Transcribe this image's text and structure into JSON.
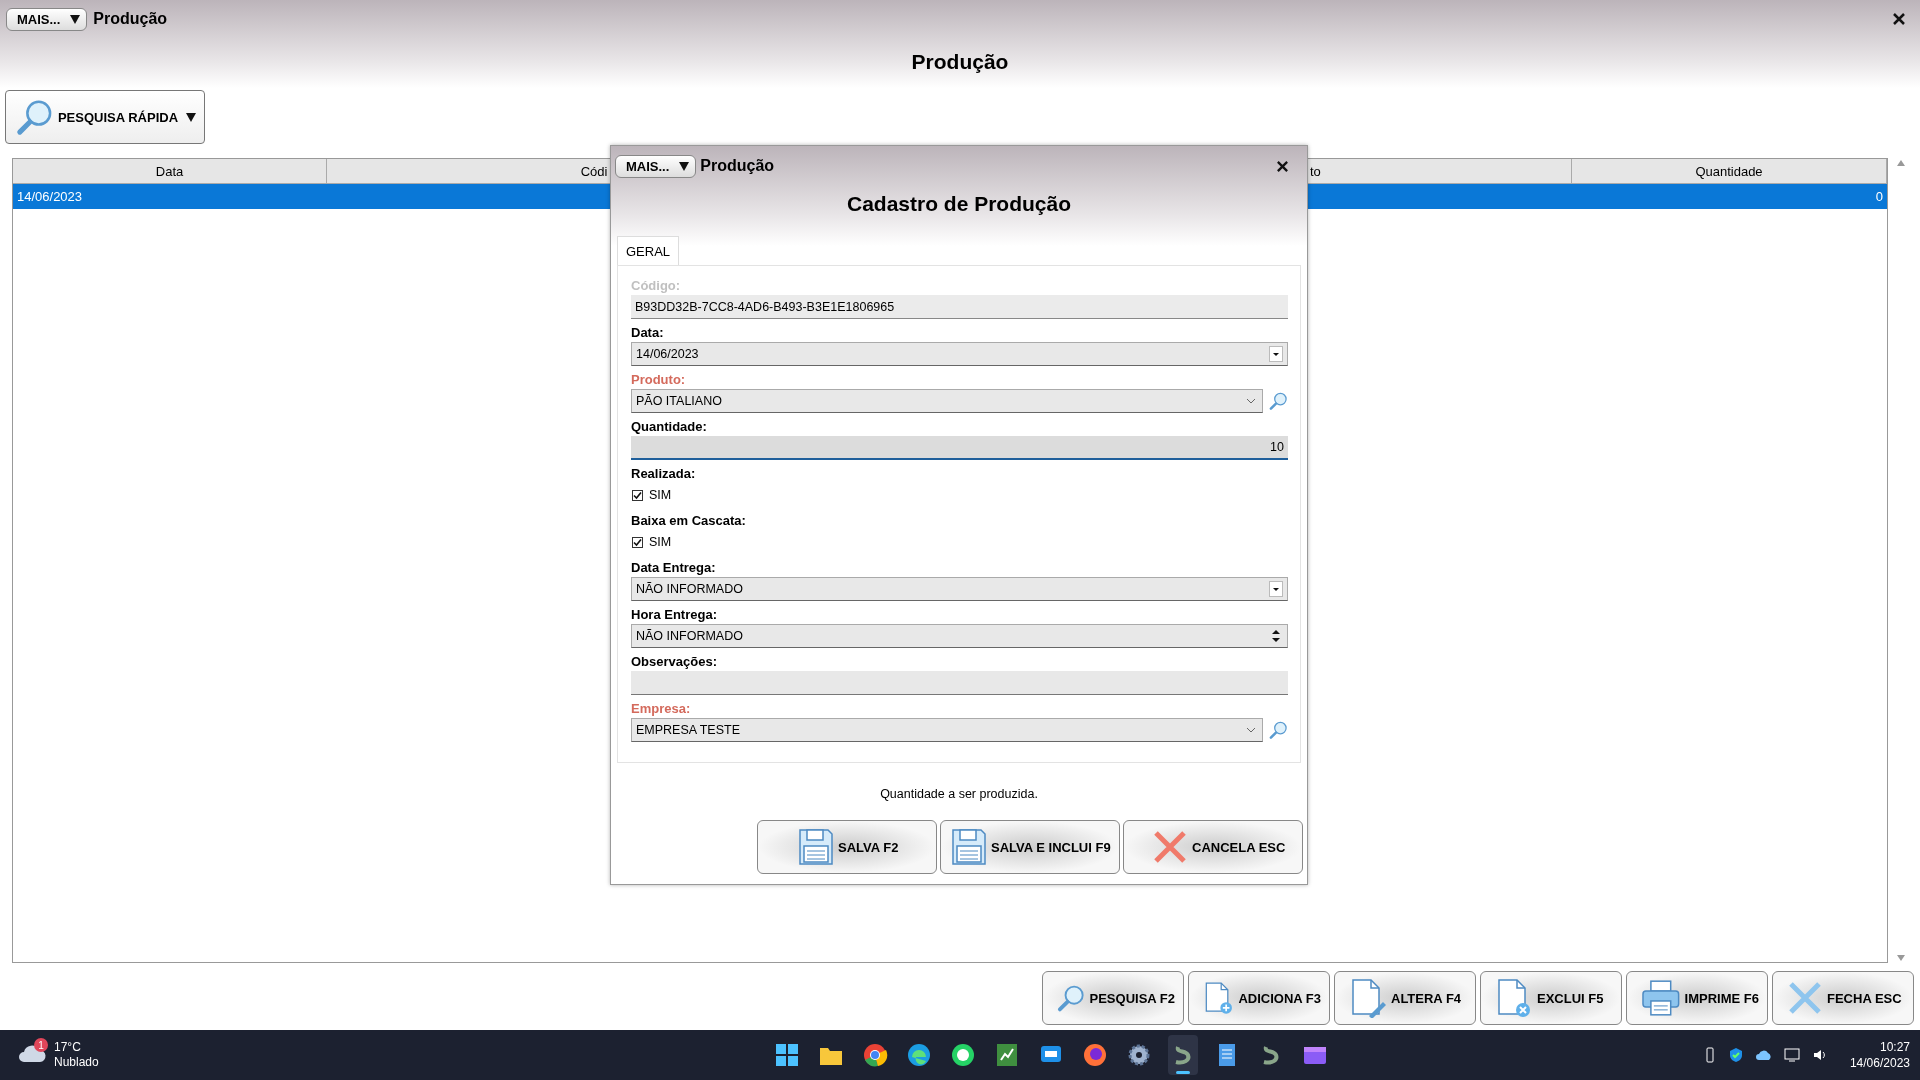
{
  "window": {
    "menu_button": "MAIS...",
    "title": "Produção",
    "heading": "Produção"
  },
  "quick_search": {
    "label": "PESQUISA RÁPIDA"
  },
  "table": {
    "columns": [
      "Data",
      "Códi",
      "to",
      "Quantidade"
    ],
    "rows": [
      {
        "data": "14/06/2023",
        "quantidade": "0",
        "selected": true
      }
    ]
  },
  "dialog": {
    "menu_button": "MAIS...",
    "title": "Produção",
    "heading": "Cadastro de Produção",
    "tabs": [
      {
        "label": "GERAL",
        "selected": true
      }
    ],
    "fields": [
      {
        "kind": "text",
        "label": "Código:",
        "value": "B93DD32B-7CC8-4AD6-B493-B3E1E1806965",
        "required": false,
        "disabled": true,
        "focused": false
      },
      {
        "kind": "dropdown",
        "label": "Data:",
        "value": "14/06/2023",
        "required": false,
        "disabled": false,
        "focused": false
      },
      {
        "kind": "lookup",
        "label": "Produto:",
        "value": "PÃO ITALIANO",
        "required": true,
        "disabled": false,
        "focused": false
      },
      {
        "kind": "number",
        "label": "Quantidade:",
        "value": "10",
        "required": false,
        "disabled": false,
        "focused": true
      },
      {
        "kind": "checkbox",
        "label": "Realizada:",
        "value": "SIM",
        "checked": true,
        "required": false,
        "disabled": false,
        "focused": false
      },
      {
        "kind": "checkbox",
        "label": "Baixa em Cascata:",
        "value": "SIM",
        "checked": true,
        "required": false,
        "disabled": false,
        "focused": false
      },
      {
        "kind": "dropdown",
        "label": "Data Entrega:",
        "value": "NÃO INFORMADO",
        "required": false,
        "disabled": false,
        "focused": false
      },
      {
        "kind": "spinner",
        "label": "Hora Entrega:",
        "value": "NÃO INFORMADO",
        "required": false,
        "disabled": false,
        "focused": false
      },
      {
        "kind": "text",
        "label": "Observações:",
        "required": false,
        "disabled": false,
        "focused": false
      },
      {
        "kind": "lookup",
        "label": "Empresa:",
        "value": "EMPRESA TESTE",
        "required": true,
        "disabled": false,
        "focused": false
      }
    ],
    "hint": "Quantidade a ser produzida.",
    "buttons": [
      {
        "kind": "save",
        "label": "SALVA F2"
      },
      {
        "kind": "save",
        "label": "SALVA E INCLUI F9"
      },
      {
        "kind": "cancel",
        "label": "CANCELA ESC"
      }
    ]
  },
  "actions": [
    {
      "kind": "search",
      "label": "PESQUISA F2"
    },
    {
      "kind": "add",
      "label": "ADICIONA F3"
    },
    {
      "kind": "edit",
      "label": "ALTERA F4"
    },
    {
      "kind": "delete",
      "label": "EXCLUI F5"
    },
    {
      "kind": "print",
      "label": "IMPRIME F6"
    },
    {
      "kind": "close",
      "label": "FECHA ESC"
    }
  ],
  "taskbar": {
    "weather": {
      "badge": "1",
      "temperature": "17°C",
      "condition": "Nublado"
    },
    "apps": [
      {
        "kind": "start"
      },
      {
        "kind": "folder"
      },
      {
        "kind": "chrome"
      },
      {
        "kind": "edge"
      },
      {
        "kind": "whatsapp"
      },
      {
        "kind": "sheet"
      },
      {
        "kind": "chat"
      },
      {
        "kind": "firefox"
      },
      {
        "kind": "gear"
      },
      {
        "kind": "app",
        "selected": true
      },
      {
        "kind": "notes",
        "selected": false
      },
      {
        "kind": "app",
        "selected": false
      },
      {
        "kind": "media",
        "selected": false
      }
    ],
    "clock": {
      "time": "10:27",
      "date": "14/06/2023"
    }
  }
}
